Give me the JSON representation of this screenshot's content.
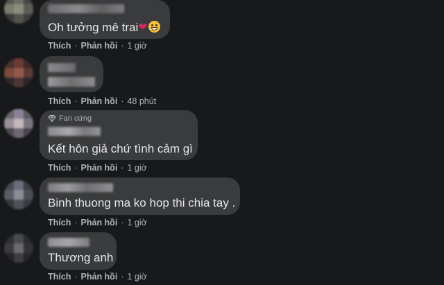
{
  "comments": [
    {
      "body": "Oh tưởng mê trai",
      "emoji_heart": "❤",
      "emoji_face": "grinning-squint-face",
      "badge": "",
      "actions": {
        "like": "Thích",
        "reply": "Phản hồi",
        "separator": "·",
        "time": "1 giờ"
      }
    },
    {
      "body": "",
      "badge": "",
      "actions": {
        "like": "Thích",
        "reply": "Phản hồi",
        "separator": "·",
        "time": "48 phút"
      }
    },
    {
      "body": "Kết hôn giả chứ tình cảm gì",
      "badge": "Fan cứng",
      "actions": {
        "like": "Thích",
        "reply": "Phản hồi",
        "separator": "·",
        "time": "1 giờ"
      }
    },
    {
      "body": "Binh thuong ma ko hop thi chia tay .",
      "badge": "",
      "actions": {
        "like": "Thích",
        "reply": "Phản hồi",
        "separator": "·",
        "time": "1 giờ"
      }
    },
    {
      "body": "Thương anh",
      "badge": "",
      "actions": {
        "like": "Thích",
        "reply": "Phản hồi",
        "separator": "·",
        "time": "1 giờ"
      }
    }
  ],
  "colors": {
    "background": "#18191a",
    "bubble": "#3a3b3c",
    "text": "#e4e6eb",
    "secondary_text": "#b0b3b8"
  }
}
